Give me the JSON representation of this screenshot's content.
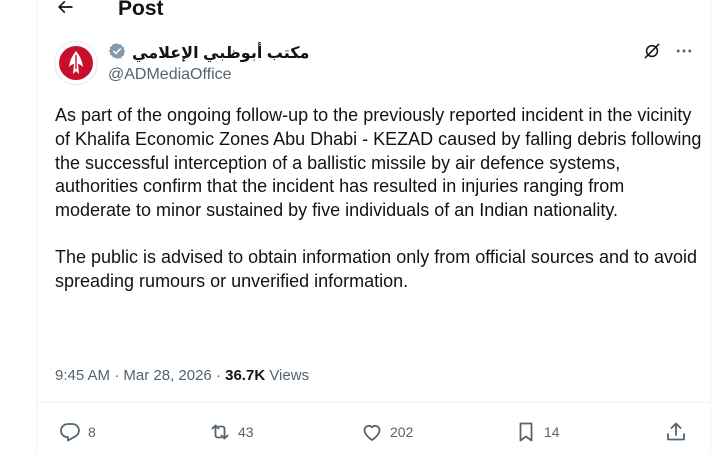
{
  "header": {
    "title": "Post"
  },
  "author": {
    "name": "مكتب أبوظبي الإعلامي",
    "handle": "@ADMediaOffice",
    "verified": true
  },
  "post": {
    "paragraphs": [
      "As part of the ongoing follow-up to the previously reported incident in the vicinity of Khalifa Economic Zones Abu Dhabi - KEZAD caused by falling debris following the successful interception of a ballistic missile by air defence systems, authorities confirm that the incident has resulted in injuries ranging from moderate to minor sustained by five individuals of an Indian nationality.",
      "The public is advised to obtain information only from official sources and to avoid spreading rumours or unverified information."
    ],
    "time": "9:45 AM",
    "date": "Mar 28, 2026",
    "views_count": "36.7K",
    "views_label": "Views"
  },
  "actions": {
    "replies": "8",
    "reposts": "43",
    "likes": "202",
    "bookmarks": "14"
  },
  "colors": {
    "text": "#0f1419",
    "secondary": "#536471",
    "verified": "#829aab",
    "logo": "#c8102e"
  },
  "icons": [
    "back-arrow-icon",
    "verified-badge-icon",
    "grok-icon",
    "more-icon",
    "reply-icon",
    "repost-icon",
    "like-icon",
    "bookmark-icon",
    "share-icon"
  ]
}
